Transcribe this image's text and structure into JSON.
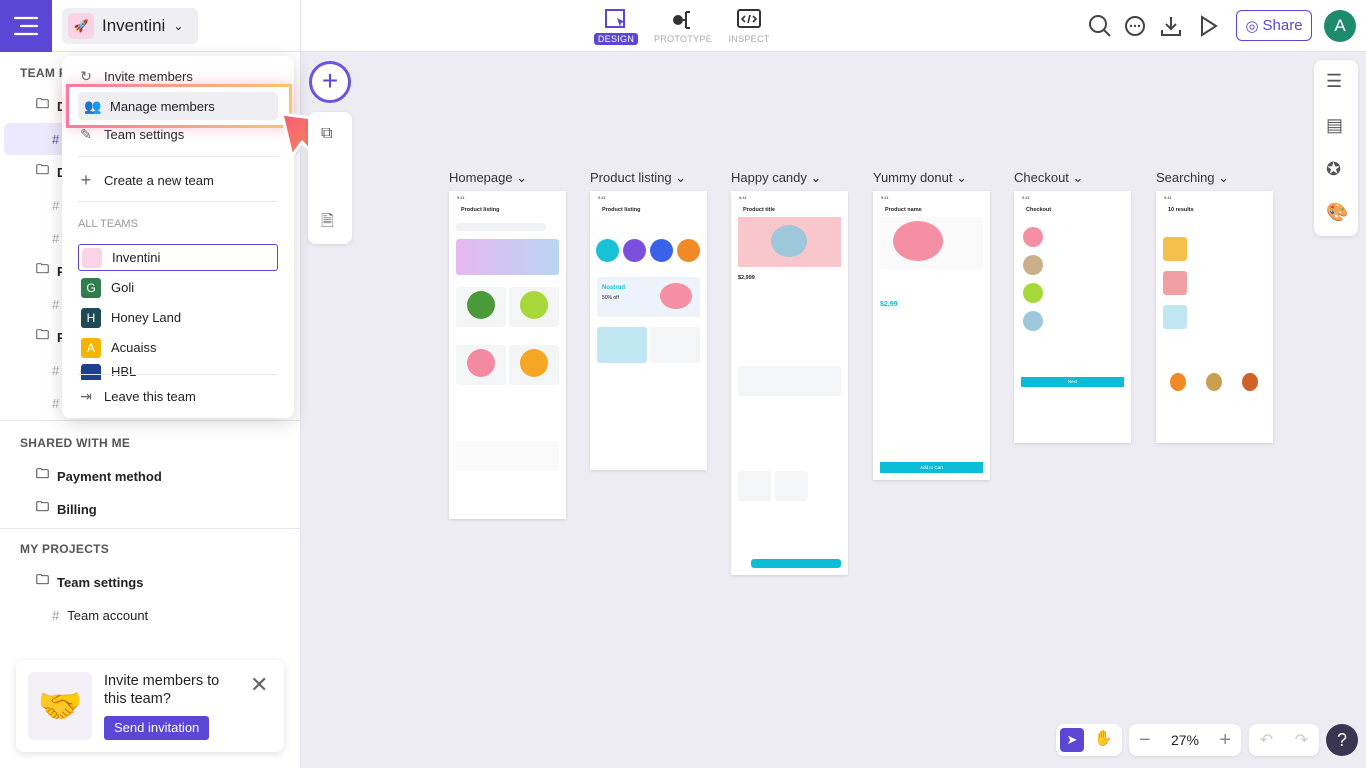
{
  "header": {
    "team_name": "Inventini",
    "modes": [
      {
        "label": "DESIGN",
        "active": true
      },
      {
        "label": "PROTOTYPE"
      },
      {
        "label": "INSPECT"
      }
    ],
    "share_label": "Share",
    "avatar_initial": "A"
  },
  "sidebar": {
    "team_projects_label": "TEAM P",
    "team_rows": [
      "D",
      "",
      "D",
      "",
      "",
      "P",
      "",
      "P",
      "",
      ""
    ],
    "shared_label": "SHARED WITH ME",
    "shared": [
      "Payment method",
      "Billing"
    ],
    "my_label": "MY PROJECTS",
    "my_projects": [
      {
        "label": "Team settings",
        "type": "folder"
      },
      {
        "label": "Team account",
        "type": "frame"
      }
    ]
  },
  "dropdown": {
    "invite_members": "Invite members",
    "manage_members": "Manage members",
    "team_settings": "Team settings",
    "create_team": "Create a new team",
    "all_teams_label": "ALL TEAMS",
    "teams": [
      {
        "name": "Inventini",
        "initial": "",
        "color": "#fbd3e6",
        "selected": true
      },
      {
        "name": "Goli",
        "initial": "G",
        "color": "#2f7d4a"
      },
      {
        "name": "Honey Land",
        "initial": "H",
        "color": "#1d4a55"
      },
      {
        "name": "Acuaiss",
        "initial": "A",
        "color": "#f4b400"
      },
      {
        "name": "HBL",
        "initial": "",
        "color": "#1f3f8c"
      }
    ],
    "leave": "Leave this team"
  },
  "invite_card": {
    "title": "Invite members to this team?",
    "button": "Send invitation"
  },
  "artboards": [
    {
      "label": "Homepage",
      "title": "Product listing"
    },
    {
      "label": "Product listing",
      "title": "Product listing",
      "promo": "Nostrud",
      "promo_sub": "50% off"
    },
    {
      "label": "Happy candy",
      "title": "Product title",
      "price": "$2,999"
    },
    {
      "label": "Yummy donut",
      "title": "Product name",
      "price": "$2,99",
      "cta": "Add to Cart"
    },
    {
      "label": "Checkout",
      "title": "Checkout",
      "cta": "Next"
    },
    {
      "label": "Searching",
      "title": "10 results"
    }
  ],
  "zoom": {
    "level": "27%"
  },
  "colors": {
    "accent": "#5b46d6",
    "cta": "#0bbcd6"
  }
}
